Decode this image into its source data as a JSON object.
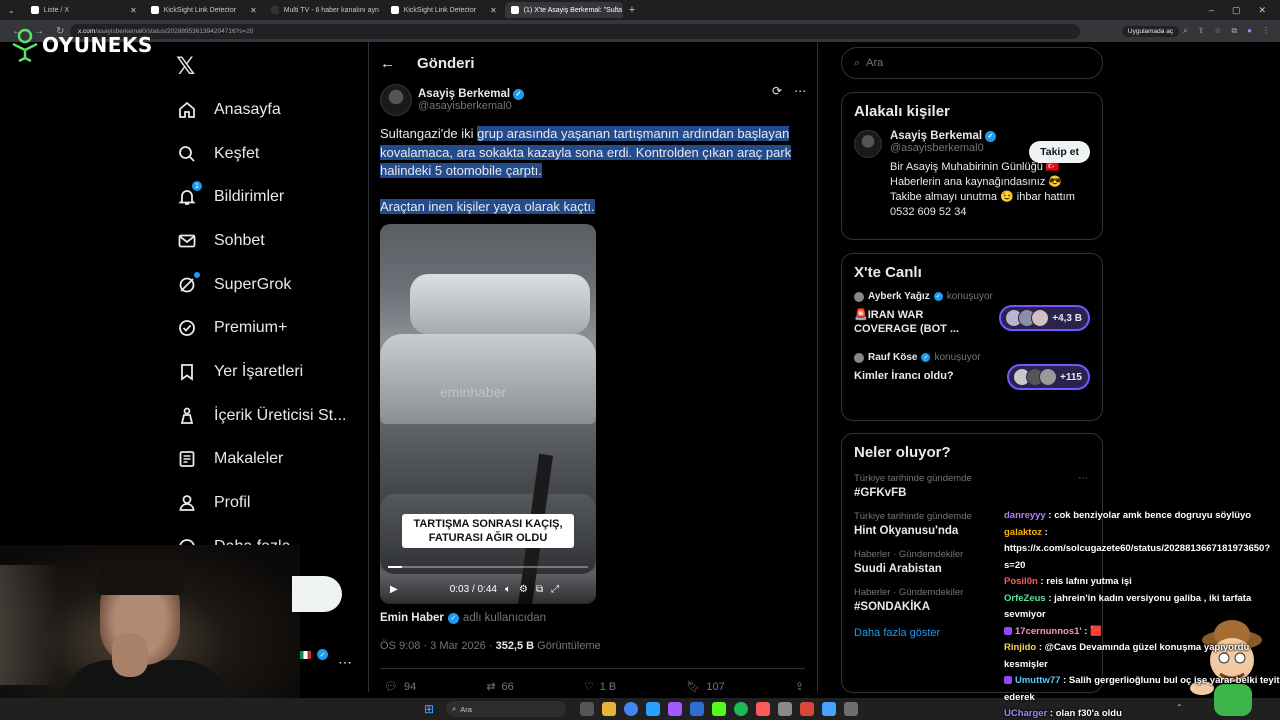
{
  "browser": {
    "tabs": [
      {
        "label": "Liste / X",
        "active": false
      },
      {
        "label": "KickSight Link Detector",
        "active": false
      },
      {
        "label": "Multi TV - 6 haber kanalını ayn",
        "active": false
      },
      {
        "label": "KickSight Link Detector",
        "active": false
      },
      {
        "label": "(1) X'te Asayiş Berkemal: \"Sulta",
        "active": true
      }
    ],
    "url_host": "x.com",
    "url_path": "/asayisberkemal0/status/2028895361394204716?s=20",
    "app_notice": "Uygulamada aç"
  },
  "overlay": {
    "logo_text": "OYUNEKS"
  },
  "nav": {
    "items": [
      {
        "label": "Anasayfa",
        "icon": "home-icon"
      },
      {
        "label": "Keşfet",
        "icon": "search-icon"
      },
      {
        "label": "Bildirimler",
        "icon": "bell-icon",
        "badge": "1"
      },
      {
        "label": "Sohbet",
        "icon": "mail-icon"
      },
      {
        "label": "SuperGrok",
        "icon": "grok-icon"
      },
      {
        "label": "Premium+",
        "icon": "verified-icon"
      },
      {
        "label": "Yer İşaretleri",
        "icon": "bookmark-icon"
      },
      {
        "label": "İçerik Üreticisi St...",
        "icon": "creator-icon"
      },
      {
        "label": "Makaleler",
        "icon": "article-icon"
      },
      {
        "label": "Profil",
        "icon": "profile-icon"
      },
      {
        "label": "Daha fazla",
        "icon": "more-icon"
      }
    ]
  },
  "post": {
    "header_title": "Gönderi",
    "author_name": "Asayiş Berkemal",
    "author_handle": "@asayisberkemal0",
    "text_p1_plain": "Sultangazi'de iki ",
    "text_p1_highlighted": "grup arasında yaşanan tartışmanın ardından başlayan kovalamaca, ara sokakta kazayla sona erdi. Kontrolden çıkan araç park halindeki 5 otomobile çarptı.",
    "text_p2": "Araçtan inen kişiler yaya olarak kaçtı.",
    "video": {
      "watermark": "eminhaber",
      "caption_line1": "TARTIŞMA SONRASI KAÇIŞ,",
      "caption_line2": "FATURASI AĞIR OLDU",
      "time": "0:03 / 0:44",
      "progress": 0.068
    },
    "source_name": "Emin Haber",
    "source_via": "adlı kullanıcıdan",
    "time": "ÖS 9:08",
    "date": "3 Mar 2026",
    "views": "352,5 B",
    "views_label": "Görüntüleme",
    "replies": "94",
    "reposts": "66",
    "likes": "1 B",
    "bookmarks": "107"
  },
  "sidebar": {
    "search_placeholder": "Ara",
    "related_title": "Alakalı kişiler",
    "related_name": "Asayiş Berkemal",
    "related_handle": "@asayisberkemal0",
    "follow_label": "Takip et",
    "bio_line1": "Bir Asayiş Muhabirinin Günlüğü 🇹🇷",
    "bio_line2": "Haberlerin ana kaynağındasınız 😎",
    "bio_line3": "Takibe almayı unutma 😉 ihbar hattım",
    "bio_line4": "0532 609 52 34",
    "live_title": "X'te Canlı",
    "live": [
      {
        "host": "Ayberk Yağız",
        "status": "konuşuyor",
        "title": "🚨IRAN WAR COVERAGE (BOT ...",
        "count": "+4,3 B"
      },
      {
        "host": "Rauf Köse",
        "status": "konuşuyor",
        "title": "Kimler İrancı oldu?",
        "count": "+115"
      }
    ],
    "trends_title": "Neler oluyor?",
    "trends": [
      {
        "context": "Türkiye tarihinde gündemde",
        "name": "#GFKvFB"
      },
      {
        "context": "Türkiye tarihinde gündemde",
        "name": "Hint Okyanusu'nda"
      },
      {
        "context": "Haberler · Gündemdekiler",
        "name": "Suudi Arabistan"
      },
      {
        "context": "Haberler · Gündemdekiler",
        "name": "#SONDAKİKA"
      }
    ],
    "show_more": "Daha fazla göster"
  },
  "chat": [
    {
      "user": "danreyyy",
      "color": "#b97cff",
      "text": "cok benziyolar amk bence dogruyu söylüyo"
    },
    {
      "user": "galaktoz",
      "color": "#ffb400",
      "text": "https://x.com/solcugazete60/status/2028813667181973650?s=20"
    },
    {
      "user": "Posil0n",
      "color": "#ff5b5b",
      "text": "reis lafını yutma işi"
    },
    {
      "user": "OrfeZeus",
      "color": "#56e39f",
      "text": "jahrein'in kadın versiyonu galiba , iki tarfata sevmiyor"
    },
    {
      "user": "17cernunnos1'",
      "color": "#ff8fc8",
      "text": "🟥",
      "sub": true
    },
    {
      "user": "Rinjido",
      "color": "#ffd24a",
      "text": "@Cavs Devamında güzel konuşma yapıyordu kesmişler"
    },
    {
      "user": "Umuttw77",
      "color": "#5bc8ff",
      "text": "Salih gergerlioğlunu bul oç işe yarar belki teyit ederek",
      "sub": true
    },
    {
      "user": "UCharger",
      "color": "#9b8cff",
      "text": "olan f30'a oldu"
    }
  ],
  "taskbar": {
    "search_placeholder": "Ara"
  },
  "colors": {
    "accent": "#1d9bf0",
    "background": "#000000",
    "highlight": "#244b8e",
    "border": "#2f3336",
    "muted": "#71767b"
  }
}
